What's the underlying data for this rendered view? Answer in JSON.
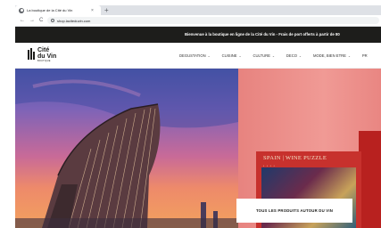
{
  "browser": {
    "tab_title": "La boutique de la Cité du Vin",
    "close_glyph": "×",
    "new_tab_glyph": "+",
    "url": "shop.laciteduvin.com"
  },
  "site": {
    "announcement": "Bienvenue à la boutique en ligne de la Cité du Vin - Frais de port offerts à partir de 80",
    "logo": {
      "line1": "Cité",
      "line2": "du Vin",
      "line3": "BOUTIQUE"
    },
    "menu": [
      {
        "label": "DEGUSTATION",
        "chev": "⌄"
      },
      {
        "label": "CUISINE",
        "chev": "⌄"
      },
      {
        "label": "CULTURE",
        "chev": "⌄"
      },
      {
        "label": "DECO",
        "chev": "⌄"
      },
      {
        "label": "MODE, BIEN ETRE",
        "chev": "⌄"
      },
      {
        "label": "PR",
        "chev": ""
      }
    ]
  },
  "hero": {
    "puzzle_title": "SPAIN | WINE PUZZLE",
    "puzzle_dots": "• • • •",
    "cta_label": "TOUS LES PRODUITS AUTOUR DU VIN"
  },
  "icons": {
    "back": "←",
    "forward": "→",
    "reload": "C"
  }
}
